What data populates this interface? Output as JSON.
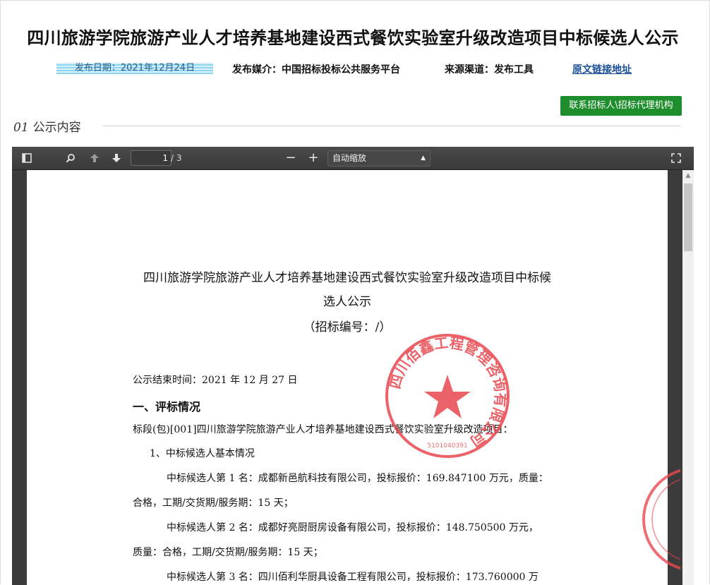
{
  "page": {
    "title": "四川旅游学院旅游产业人才培养基地建设西式餐饮实验室升级改造项目中标候选人公示",
    "publish_date": "发布日期：2021年12月24日",
    "publish_media": "发布媒介：中国招标投标公共服务平台",
    "source_channel": "来源渠道：发布工具",
    "source_link": "原文链接地址",
    "contact_button": "联系招标人\\招标代理机构",
    "section_number": "01",
    "section_title": "公示内容"
  },
  "viewer": {
    "page_current": "1",
    "page_total": "/ 3",
    "zoom": "自动缩放",
    "icons": [
      "sidebar-toggle-icon",
      "search-icon",
      "previous-page-icon",
      "next-page-icon",
      "zoom-out-icon",
      "zoom-in-icon",
      "fullscreen-icon"
    ]
  },
  "document": {
    "title_line1": "四川旅游学院旅游产业人才培养基地建设西式餐饮实验室升级改造项目中标候",
    "title_line2": "选人公示",
    "bid_number": "（招标编号：/）",
    "end_time": "公示结束时间：2021 年 12 月 27 日",
    "section1": "一、评标情况",
    "lot": "标段(包)[001]四川旅游学院旅游产业人才培养基地建设西式餐饮实验室升级改造项目：",
    "sub1": "1、中标候选人基本情况",
    "c1_a": "中标候选人第 1 名：成都新邑航科技有限公司，投标报价：169.847100 万元，质量：",
    "c1_b": "合格，工期/交货期/服务期：15 天；",
    "c2_a": "中标候选人第 2 名：成都好亮厨厨房设备有限公司，投标报价：148.750500 万元，",
    "c2_b": "质量：合格，工期/交货期/服务期：15 天；",
    "c3_a": "中标候选人第 3 名：四川佰利华厨具设备工程有限公司，投标报价：173.760000 万"
  },
  "seal": {
    "text": "四川佰鑫工程管理咨询有限公司",
    "number": "5101040391",
    "color": "#e8484f"
  }
}
